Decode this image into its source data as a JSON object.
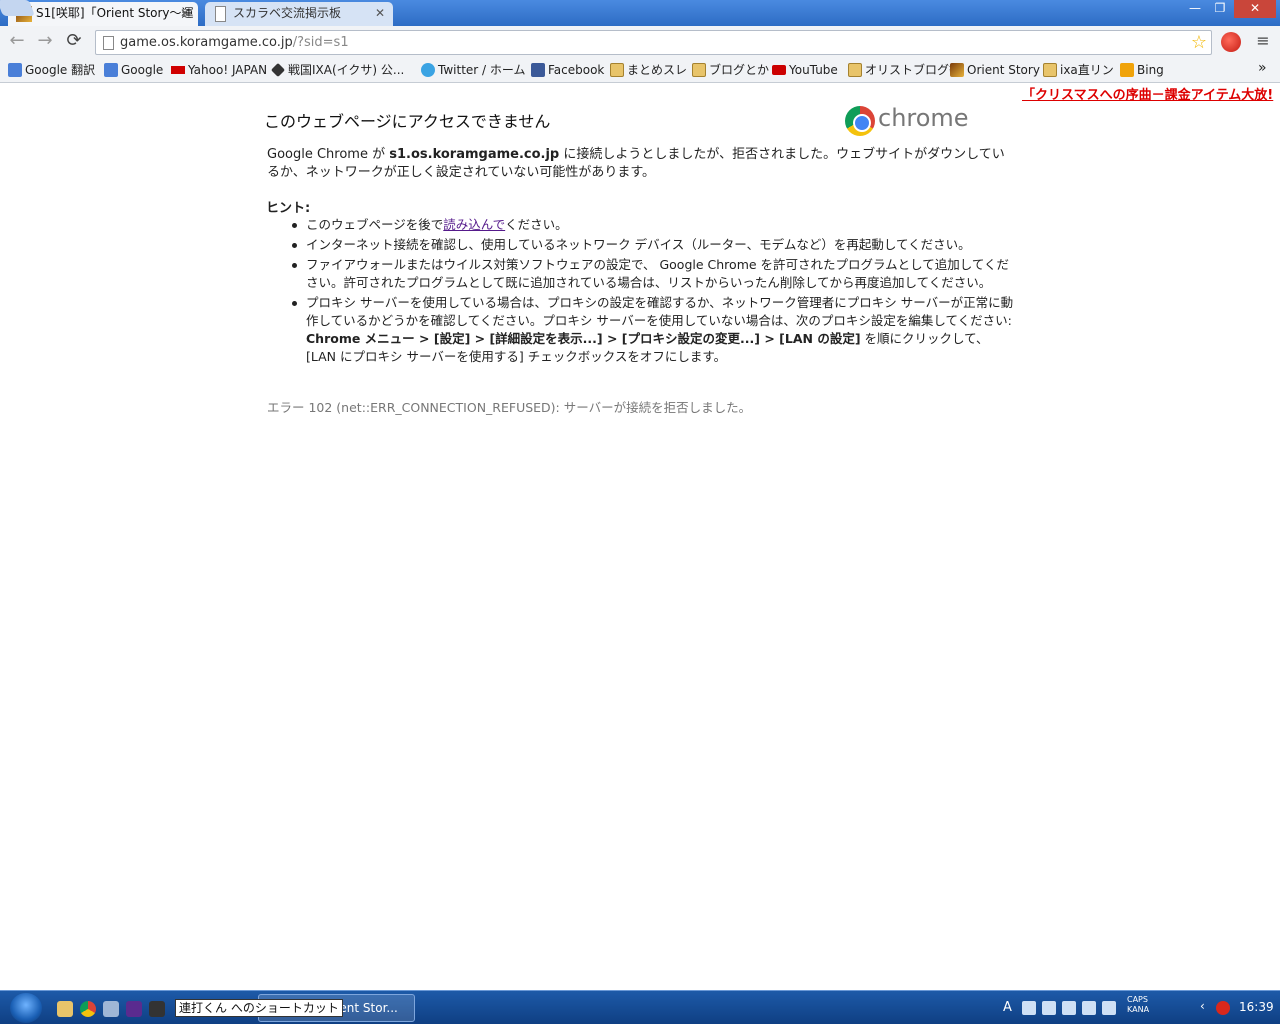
{
  "tabs": [
    {
      "label": "S1[咲耶]「Orient Story〜運",
      "active": true
    },
    {
      "label": "スカラベ交流掲示板",
      "active": false
    }
  ],
  "window_buttons": {
    "minimize": "—",
    "maximize": "❐",
    "close": "✕"
  },
  "toolbar": {
    "url_host": "game.os.koramgame.co.jp",
    "url_rest": "/?sid=s1",
    "back": "←",
    "forward": "→",
    "reload": "⟳",
    "menu": "≡",
    "star": "☆"
  },
  "bookmarks": [
    {
      "label": "Google 翻訳",
      "icon": "translate-icon",
      "color": "#4a7fd8"
    },
    {
      "label": "Google",
      "icon": "google-icon",
      "color": "#4a7fd8"
    },
    {
      "label": "Yahoo! JAPAN",
      "icon": "yahoo-icon",
      "color": "#d00000"
    },
    {
      "label": "戦国IXA(イクサ) 公...",
      "icon": "ixa-icon",
      "color": "#333333"
    },
    {
      "label": "Twitter / ホーム",
      "icon": "twitter-icon",
      "color": "#3aa3e3"
    },
    {
      "label": "Facebook",
      "icon": "facebook-icon",
      "color": "#3b5998"
    },
    {
      "label": "まとめスレ",
      "icon": "folder-icon",
      "color": ""
    },
    {
      "label": "ブログとか",
      "icon": "folder-icon",
      "color": ""
    },
    {
      "label": "YouTube",
      "icon": "youtube-icon",
      "color": "#cc0000"
    },
    {
      "label": "オリストブログ等",
      "icon": "folder-icon",
      "color": ""
    },
    {
      "label": "Orient Story",
      "icon": "orient-story-icon",
      "color": "#8a4b10"
    },
    {
      "label": "ixa直リン",
      "icon": "folder-icon",
      "color": ""
    },
    {
      "label": "Bing",
      "icon": "bing-icon",
      "color": "#f0a30a"
    }
  ],
  "overflow": "»",
  "page": {
    "promo": "「クリスマスへの序曲－課金アイテム大放!",
    "title": "このウェブページにアクセスできません",
    "chrome_word": "chrome",
    "summary_pre": "Google Chrome が ",
    "summary_host": "s1.os.koramgame.co.jp",
    "summary_post": " に接続しようとしましたが、拒否されました。ウェブサイトがダウンしているか、ネットワークが正しく設定されていない可能性があります。",
    "hint_label": "ヒント:",
    "hint1_pre": "このウェブページを後で",
    "hint1_link": "読み込んで",
    "hint1_post": "ください。",
    "hint2": "インターネット接続を確認し、使用しているネットワーク デバイス（ルーター、モデムなど）を再起動してください。",
    "hint3": "ファイアウォールまたはウイルス対策ソフトウェアの設定で、 Google Chrome を許可されたプログラムとして追加してください。許可されたプログラムとして既に追加されている場合は、リストからいったん削除してから再度追加してください。",
    "hint4_pre": "プロキシ サーバーを使用している場合は、プロキシの設定を確認するか、ネットワーク管理者にプロキシ サーバーが正常に動作しているかどうかを確認してください。プロキシ サーバーを使用していない場合は、次のプロキシ設定を編集してください: ",
    "hint4_bold": "Chrome メニュー > [設定] > [詳細設定を表示...] > [プロキシ設定の変更...] > [LAN の設定]",
    "hint4_post": " を順にクリックして、[LAN にプロキシ サーバーを使用する] チェックボックスをオフにします。",
    "error_code": "エラー 102 (net::ERR_CONNECTION_REFUSED): サーバーが接続を拒否しました。"
  },
  "taskbar": {
    "tooltip": "連打くん へのショートカット",
    "window_label": "咲耶]「Orient Stor...",
    "caps": "CAPS",
    "kana": "KANA",
    "clock": "16:39",
    "ime": "A"
  }
}
